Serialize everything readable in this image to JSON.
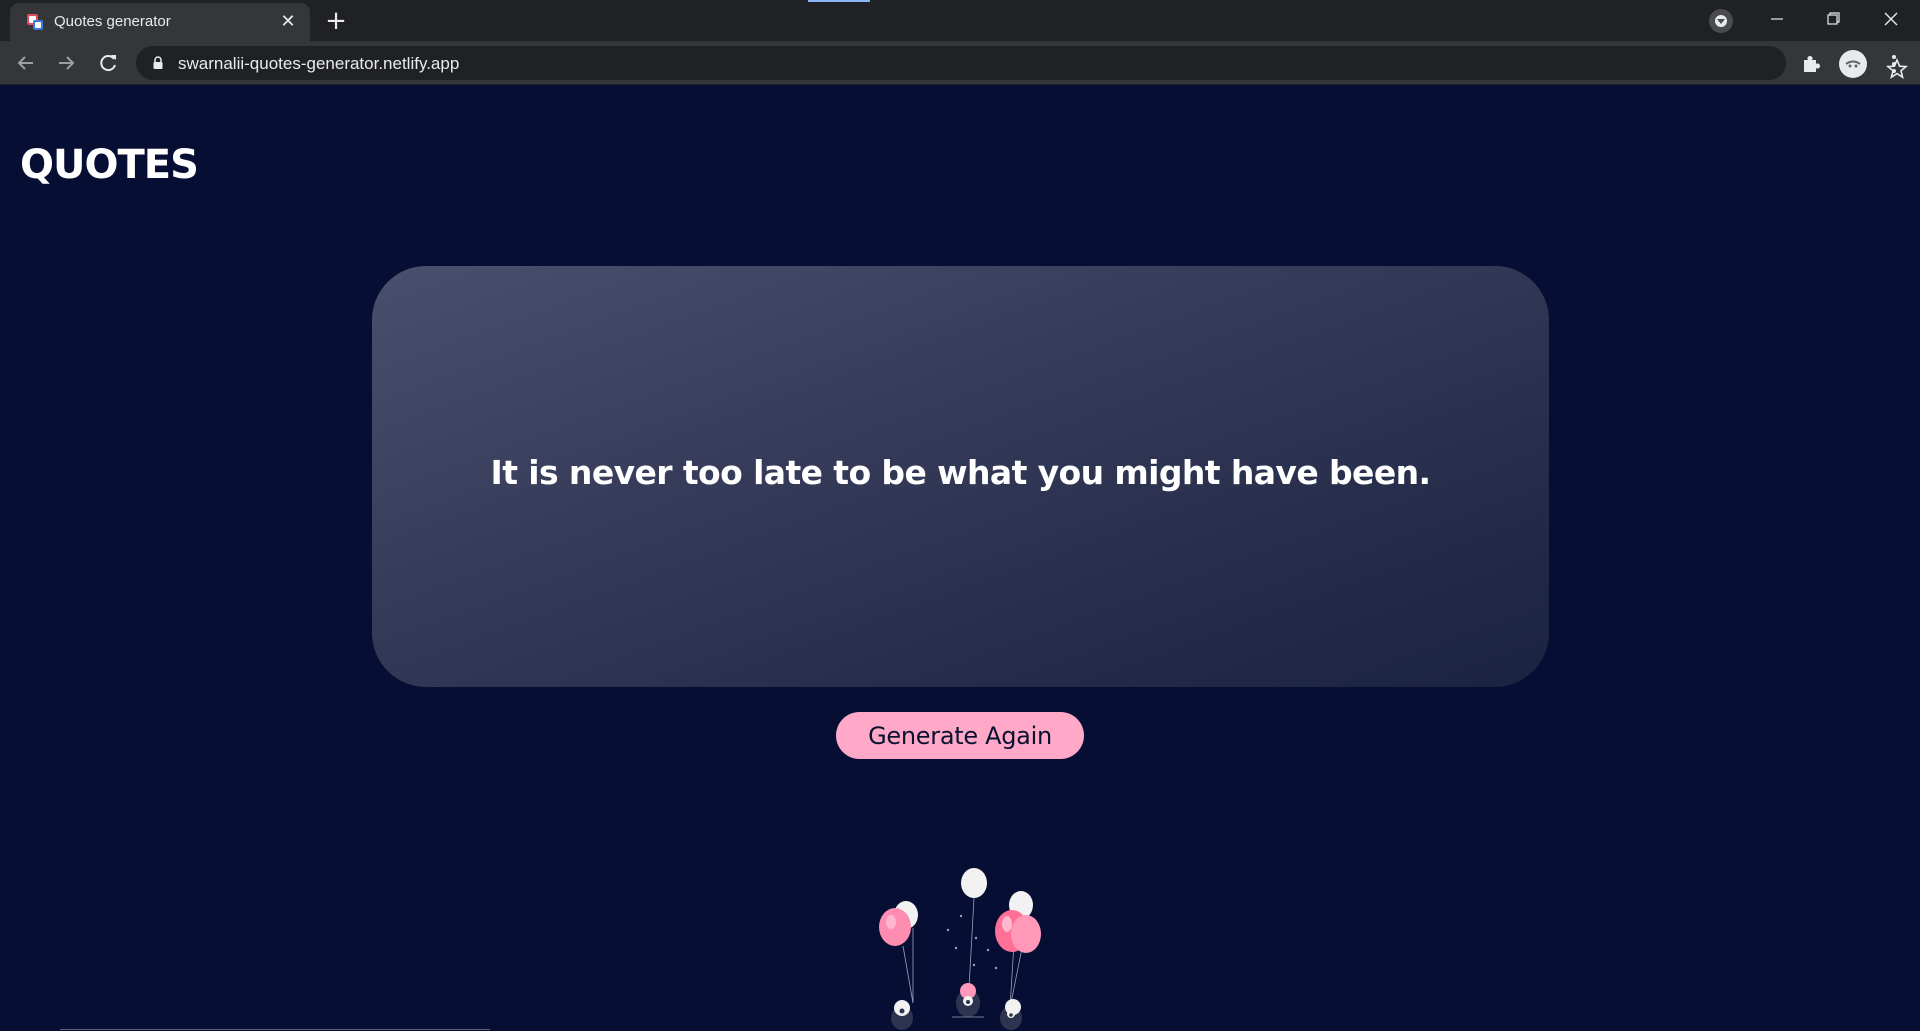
{
  "browser": {
    "tab": {
      "title": "Quotes generator",
      "close_label": "✕"
    },
    "new_tab_label": "+",
    "address": {
      "url": "swarnalii-quotes-generator.netlify.app"
    }
  },
  "page": {
    "heading": "QUOTES",
    "quote": "It is never too late to be what you might have been.",
    "button_label": "Generate Again"
  },
  "colors": {
    "background": "#060f33",
    "card_gradient_start": "#4a4f6d",
    "card_gradient_end": "#1b2343",
    "button": "#ffa8c8",
    "balloon_pink": "#ff7fa8",
    "balloon_white": "#f2f2f2"
  },
  "icons": {
    "favicon": "quotes-favicon",
    "back": "arrow-left-icon",
    "forward": "arrow-right-icon",
    "reload": "reload-icon",
    "lock": "lock-icon",
    "bookmark": "star-icon",
    "extensions": "puzzle-icon",
    "menu": "kebab-menu-icon"
  }
}
